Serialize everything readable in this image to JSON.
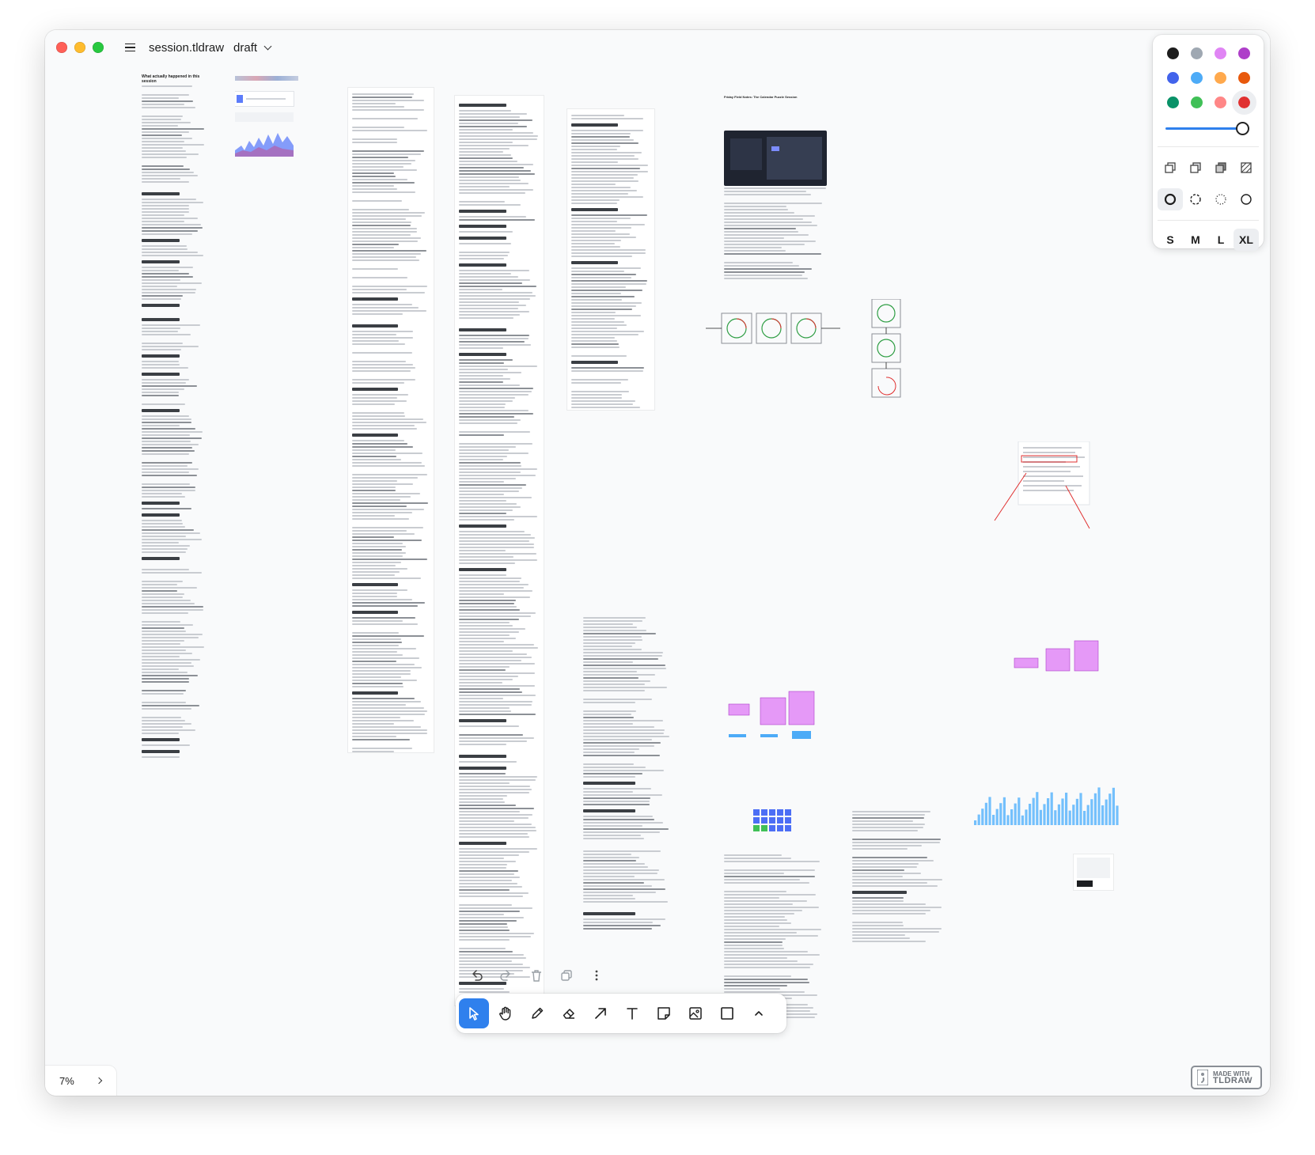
{
  "window": {
    "title": "session.tldraw",
    "status": "draft"
  },
  "canvas": {
    "zoom": "7%"
  },
  "style_panel": {
    "colors": [
      "#1d1d1d",
      "#9fa8b2",
      "#e085f4",
      "#ae3ec9",
      "#4263eb",
      "#4dabf7",
      "#ffa94d",
      "#e8590c",
      "#099268",
      "#40c057",
      "#ff8787",
      "#e03131"
    ],
    "selected_color_index": 11,
    "opacity": 1.0,
    "fills": [
      "fill-none-icon",
      "fill-semi-icon",
      "fill-solid-icon",
      "fill-pattern-icon"
    ],
    "dashes": [
      "dash-draw-icon",
      "dash-dashed-icon",
      "dash-dotted-icon",
      "dash-solid-icon"
    ],
    "selected_dash_index": 0,
    "sizes": [
      "S",
      "M",
      "L",
      "XL"
    ],
    "selected_size_index": 3
  },
  "actions": [
    "undo-icon",
    "redo-icon",
    "delete-icon",
    "duplicate-icon",
    "more-icon"
  ],
  "toolbar": {
    "tools": [
      "select-icon",
      "hand-icon",
      "draw-icon",
      "eraser-icon",
      "arrow-icon",
      "text-icon",
      "note-icon",
      "image-icon",
      "rectangle-icon",
      "chevron-up-icon"
    ],
    "selected_index": 0
  },
  "watermark": {
    "line1": "MADE WITH",
    "line2": "TLDRAW"
  },
  "doc": {
    "title_1": "What actually happened in this session",
    "title_2": "Friday Field Notes: The Calendar Puzzle Session"
  }
}
